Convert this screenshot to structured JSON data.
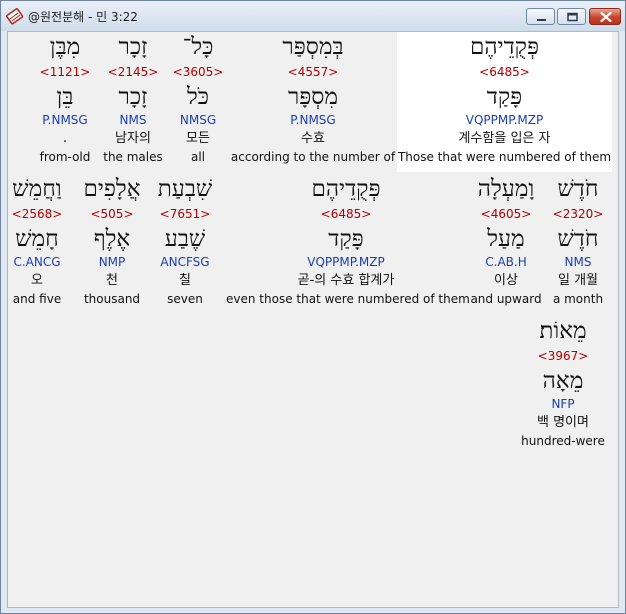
{
  "window": {
    "title": "@원전분해 - 민 3:22",
    "buttons": {
      "minimize": "minimize",
      "maximize": "maximize",
      "close": "close"
    }
  },
  "icons": {
    "app": "bible-book-icon"
  },
  "colors": {
    "hebrew": "#111111",
    "strong_number": "#b00000",
    "parsing": "#1a3db5",
    "highlight_background": "#ffffff"
  },
  "rows": [
    {
      "words": [
        {
          "hebrew": "מִבֶּן",
          "strong": "<1121>",
          "lexeme": "בֵּן",
          "parsing": "P.NMSG",
          "korean": ".",
          "english": "from-old"
        },
        {
          "hebrew": "זָכָר",
          "strong": "<2145>",
          "lexeme": "זָכָר",
          "parsing": "NMS",
          "korean": "남자의",
          "english": "the males"
        },
        {
          "hebrew": "כָּל־",
          "strong": "<3605>",
          "lexeme": "כֹּל",
          "parsing": "NMSG",
          "korean": "모든",
          "english": "all"
        },
        {
          "hebrew": "בְּמִסְפַּר",
          "strong": "<4557>",
          "lexeme": "מִסְפָּר",
          "parsing": "P.NMSG",
          "korean": "수효",
          "english": "according to the number of"
        },
        {
          "hebrew": "פְּקֻדֵיהֶם",
          "strong": "<6485>",
          "lexeme": "פָּקַד",
          "parsing": "VQPPMP.MZP",
          "korean": "계수함을 입은 자",
          "english": "Those that were numbered of them",
          "highlighted": true
        }
      ]
    },
    {
      "words": [
        {
          "hebrew": "וַחֲמֵשׁ",
          "strong": "<2568>",
          "lexeme": "חָמֵשׁ",
          "parsing": "C.ANCG",
          "korean": "오",
          "english": "and five"
        },
        {
          "hebrew": "אֲלָפִים",
          "strong": "<505>",
          "lexeme": "אֶלֶף",
          "parsing": "NMP",
          "korean": "천",
          "english": "thousand"
        },
        {
          "hebrew": "שִׁבְעַת",
          "strong": "<7651>",
          "lexeme": "שֶׁבַע",
          "parsing": "ANCFSG",
          "korean": "칠",
          "english": "seven"
        },
        {
          "hebrew": "פְּקֻדֵיהֶם",
          "strong": "<6485>",
          "lexeme": "פָּקַד",
          "parsing": "VQPPMP.MZP",
          "korean": "곧-의 수효 합계가",
          "english": "even those that were numbered of them"
        },
        {
          "hebrew": "וָמַעְלָה",
          "strong": "<4605>",
          "lexeme": "מַעַל",
          "parsing": "C.AB.H",
          "korean": "이상",
          "english": "and upward"
        },
        {
          "hebrew": "חֹדֶשׁ",
          "strong": "<2320>",
          "lexeme": "חֹדֶשׁ",
          "parsing": "NMS",
          "korean": "일 개월",
          "english": "a month"
        }
      ]
    },
    {
      "words": [
        {
          "hebrew": "מֵאוֹת׃",
          "strong": "<3967>",
          "lexeme": "מֵאָה",
          "parsing": "NFP",
          "korean": "백 명이며",
          "english": "hundred-were"
        }
      ]
    }
  ]
}
